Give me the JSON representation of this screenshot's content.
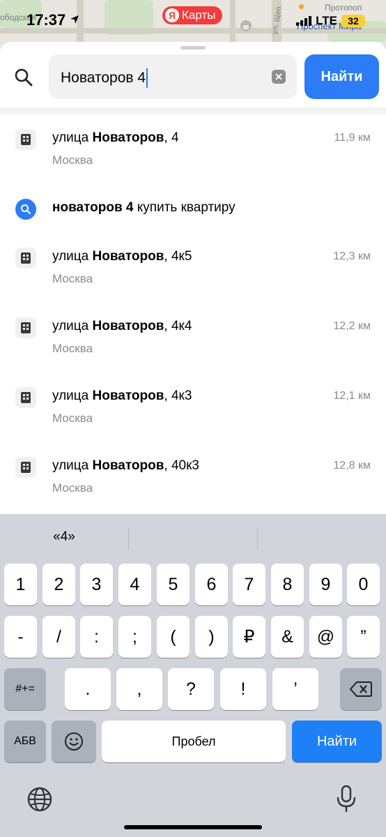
{
  "status_bar": {
    "time": "17:37",
    "network": "LTE",
    "battery": "32",
    "app_name": "Карты",
    "app_logo_letter": "Я"
  },
  "map_labels": {
    "left": "ободская",
    "street": "ул. Щеп",
    "top_right": "Протопоп",
    "metro": "Проспект Мира"
  },
  "search": {
    "query": "Новаторов 4",
    "find_label": "Найти"
  },
  "results": [
    {
      "type": "address",
      "prefix": "улица ",
      "bold": "Новаторов",
      "suffix": ", 4",
      "subtitle": "Москва",
      "distance": "11,9 км"
    },
    {
      "type": "query",
      "prefix": "",
      "bold": "новаторов 4",
      "suffix": " купить квартиру",
      "subtitle": "",
      "distance": ""
    },
    {
      "type": "address",
      "prefix": "улица ",
      "bold": "Новаторов",
      "suffix": ", 4к5",
      "subtitle": "Москва",
      "distance": "12,3 км"
    },
    {
      "type": "address",
      "prefix": "улица ",
      "bold": "Новаторов",
      "suffix": ", 4к4",
      "subtitle": "Москва",
      "distance": "12,2 км"
    },
    {
      "type": "address",
      "prefix": "улица ",
      "bold": "Новаторов",
      "suffix": ", 4к3",
      "subtitle": "Москва",
      "distance": "12,1 км"
    },
    {
      "type": "address",
      "prefix": "улица ",
      "bold": "Новаторов",
      "suffix": ", 40к3",
      "subtitle": "Москва",
      "distance": "12,8 км"
    }
  ],
  "keyboard": {
    "prediction": "«4»",
    "row1": [
      "1",
      "2",
      "3",
      "4",
      "5",
      "6",
      "7",
      "8",
      "9",
      "0"
    ],
    "row2": [
      "-",
      "/",
      ":",
      ";",
      "(",
      ")",
      "₽",
      "&",
      "@",
      "”"
    ],
    "row3_left": "#+=",
    "row3": [
      ".",
      ",",
      "?",
      "!",
      "’"
    ],
    "lang_key": "АБВ",
    "space_label": "Пробел",
    "return_label": "Найти"
  },
  "colors": {
    "accent": "#2b7cf6",
    "keyboard_bg": "#d1d4db",
    "app_red": "#f33b3b"
  }
}
